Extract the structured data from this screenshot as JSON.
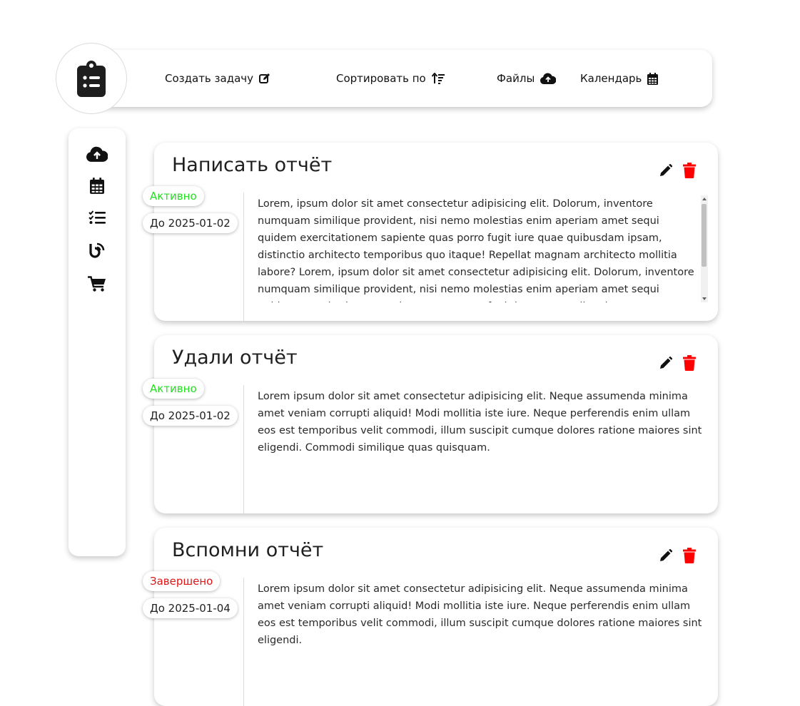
{
  "colors": {
    "active": "#22e01f",
    "done": "#e01515",
    "delete": "#ff0000",
    "icon": "#111111"
  },
  "header": {
    "logo_icon": "clipboard-list-icon",
    "nav": [
      {
        "label": "Создать задачу",
        "icon": "edit-icon"
      },
      {
        "label": "Сортировать по",
        "icon": "sort-icon"
      },
      {
        "label": "Файлы",
        "icon": "cloud-upload-icon"
      },
      {
        "label": "Календарь",
        "icon": "calendar-icon"
      }
    ]
  },
  "sidebar": {
    "items": [
      {
        "icon": "cloud-upload-icon"
      },
      {
        "icon": "calendar-icon"
      },
      {
        "icon": "list-check-icon"
      },
      {
        "icon": "blog-icon"
      },
      {
        "icon": "shopping-cart-icon"
      }
    ]
  },
  "tasks": [
    {
      "title": "Написать отчёт",
      "status": "Активно",
      "deadline": "До 2025-01-02",
      "text": "Lorem, ipsum dolor sit amet consectetur adipisicing elit. Dolorum, inventore numquam similique provident, nisi nemo molestias enim aperiam amet sequi quidem exercitationem sapiente quas porro fugit iure quae quibusdam ipsam, distinctio architecto temporibus quo itaque! Repellat magnam architecto mollitia labore? Lorem, ipsum dolor sit amet consectetur adipisicing elit. Dolorum, inventore numquam similique provident, nisi nemo molestias enim aperiam amet sequi quidem exercitationem sapiente quas porro fugit iure quae quibusdam"
    },
    {
      "title": "Удали отчёт",
      "status": "Активно",
      "deadline": "До 2025-01-02",
      "text": "Lorem ipsum dolor sit amet consectetur adipisicing elit. Neque assumenda minima amet veniam corrupti aliquid! Modi mollitia iste iure. Neque perferendis enim ullam eos est temporibus velit commodi, illum suscipit cumque dolores ratione maiores sint eligendi. Commodi similique quas quisquam."
    },
    {
      "title": "Вспомни отчёт",
      "status": "Завершено",
      "deadline": "До 2025-01-04",
      "text": "Lorem ipsum dolor sit amet consectetur adipisicing elit. Neque assumenda minima amet veniam corrupti aliquid! Modi mollitia iste iure. Neque perferendis enim ullam eos est temporibus velit commodi, illum suscipit cumque dolores ratione maiores sint eligendi."
    }
  ]
}
